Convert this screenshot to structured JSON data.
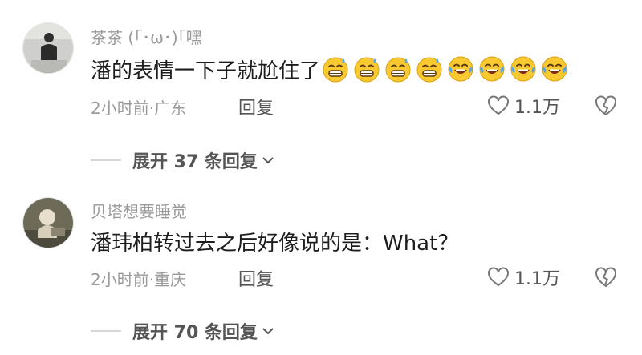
{
  "comments": [
    {
      "username": "茶茶 (｢･ω･)｢嘿",
      "text": "潘的表情一下子就尬住了",
      "emojis": [
        "laugh-sweat",
        "laugh-sweat",
        "laugh-sweat",
        "laugh-sweat",
        "laugh-cry",
        "laugh-cry",
        "laugh-cry",
        "laugh-cry"
      ],
      "meta": "2小时前·广东",
      "reply_label": "回复",
      "likes": "1.1万",
      "expand_label": "展开 37 条回复"
    },
    {
      "username": "贝塔想要睡觉",
      "text": "潘玮柏转过去之后好像说的是：What？",
      "meta": "2小时前·重庆",
      "reply_label": "回复",
      "likes": "1.1万",
      "expand_label": "展开 70 条回复"
    }
  ],
  "colors": {
    "meta_gray": "#9a9a9a",
    "text_dark": "#1d1d1d",
    "action_gray": "#555555",
    "emoji_yellow": "#f9c932",
    "tear_blue": "#5aa9e6"
  }
}
